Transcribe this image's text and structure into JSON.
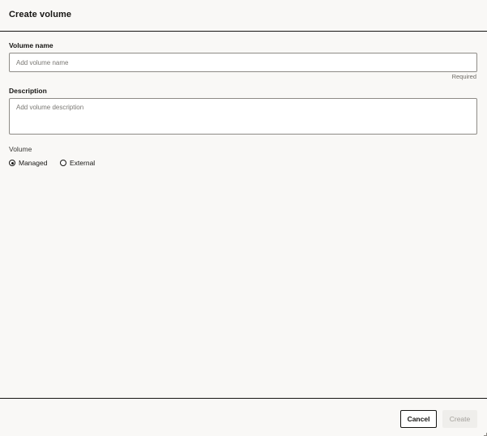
{
  "dialog": {
    "title": "Create volume"
  },
  "form": {
    "volume_name": {
      "label": "Volume name",
      "value": "",
      "placeholder": "Add volume name",
      "hint": "Required"
    },
    "description": {
      "label": "Description",
      "value": "",
      "placeholder": "Add volume description"
    },
    "volume_type": {
      "label": "Volume",
      "options": [
        {
          "label": "Managed",
          "selected": true
        },
        {
          "label": "External",
          "selected": false
        }
      ]
    }
  },
  "footer": {
    "cancel_label": "Cancel",
    "create_label": "Create"
  },
  "icons": {
    "radio_selected": "radio-selected-icon",
    "radio_unselected": "radio-unselected-icon"
  },
  "colors": {
    "background": "#f9f8f6",
    "text": "#161513",
    "disabled_button": "#efeeeb",
    "disabled_text": "#a3a09b"
  }
}
